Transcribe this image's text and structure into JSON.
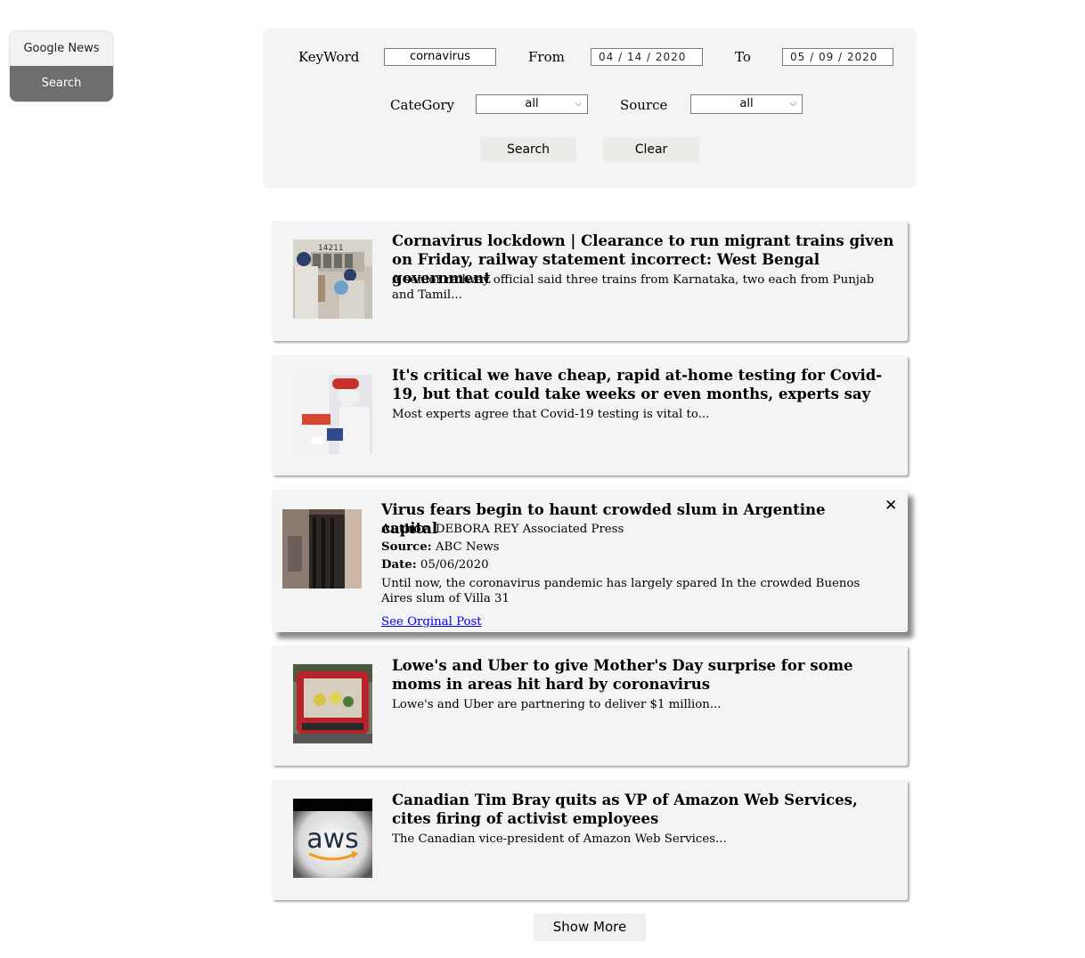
{
  "nav": {
    "news_label": "Google News",
    "search_label": "Search"
  },
  "form": {
    "keyword_label": "KeyWord",
    "keyword_value": "cornavirus",
    "from_label": "From",
    "from_value": "04 / 14 / 2020",
    "to_label": "To",
    "to_value": "05 / 09 / 2020",
    "category_label": "CateGory",
    "category_value": "all",
    "source_label": "Source",
    "source_value": "all",
    "search_button": "Search",
    "clear_button": "Clear"
  },
  "articles": [
    {
      "title": "Cornavirus lockdown | Clearance to run migrant trains given on Friday, railway statement incorrect: West Bengal government",
      "desc": "A senior railway official said three trains from Karnataka, two each from Punjab and Tamil...",
      "thumb_text": "14211"
    },
    {
      "title": "It's critical we have cheap, rapid at-home testing for Covid-19, but that could take weeks or even months, experts say",
      "desc": "Most experts agree that Covid-19 testing is vital to..."
    },
    {
      "title": "Virus fears begin to haunt crowded slum in Argentine capital",
      "author_label": "Author:",
      "author": "DEBORA REY Associated Press",
      "source_label": "Source:",
      "source": "ABC News",
      "date_label": "Date:",
      "date": "05/06/2020",
      "desc": "Until now, the coronavirus pandemic has largely spared In the crowded Buenos Aires slum of Villa 31",
      "link": "See Orginal Post",
      "close": "✕"
    },
    {
      "title": "Lowe's and Uber to give Mother's Day surprise for some moms in areas hit hard by coronavirus",
      "desc": "Lowe's and Uber are partnering to deliver $1 million..."
    },
    {
      "title": "Canadian Tim Bray quits as VP of Amazon Web Services, cites firing of activist employees",
      "desc": "The Canadian vice-president of Amazon Web Services...",
      "thumb_text": "aws"
    }
  ],
  "show_more": "Show More",
  "colors": {
    "nav_active": "#6e6e6e",
    "panel_bg": "#f4f4f4",
    "link": "#0000ee"
  }
}
